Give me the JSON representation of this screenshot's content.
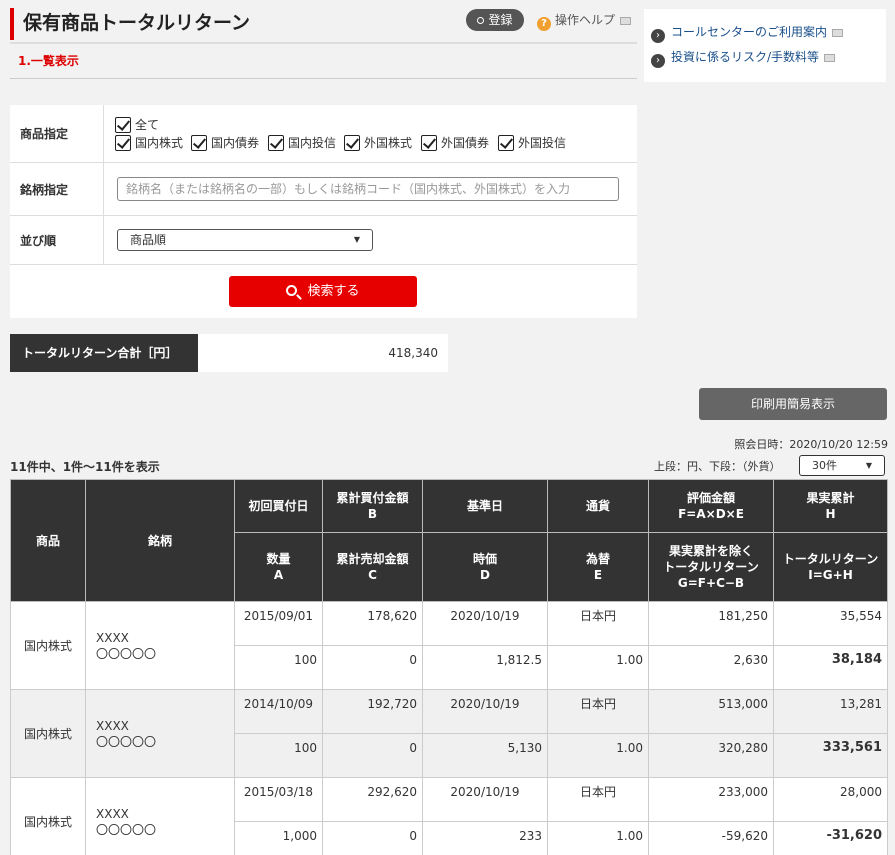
{
  "header": {
    "title": "保有商品トータルリターン",
    "register_label": "登録",
    "help_label": "操作ヘルプ",
    "section": "1.一覧表示"
  },
  "info_links": [
    {
      "label": "コールセンターのご利用案内"
    },
    {
      "label": "投資に係るリスク/手数料等"
    }
  ],
  "form": {
    "product_label": "商品指定",
    "checkboxes": [
      {
        "label": "全て",
        "checked": true
      },
      {
        "label": "国内株式",
        "checked": true
      },
      {
        "label": "国内債券",
        "checked": true
      },
      {
        "label": "国内投信",
        "checked": true
      },
      {
        "label": "外国株式",
        "checked": true
      },
      {
        "label": "外国債券",
        "checked": true
      },
      {
        "label": "外国投信",
        "checked": true
      }
    ],
    "stock_label": "銘柄指定",
    "stock_placeholder": "銘柄名（または銘柄名の一部）もしくは銘柄コード（国内株式、外国株式）を入力",
    "sort_label": "並び順",
    "sort_value": "商品順",
    "search_label": "検索する"
  },
  "total": {
    "label": "トータルリターン合計［円］",
    "value": "418,340"
  },
  "print_label": "印刷用簡易表示",
  "query_time": "照会日時：2020/10/20 12:59",
  "count_text": "11件中、1件～11件を表示",
  "units_text": "上段：円、下段：（外貨）",
  "per_page": "30件",
  "table": {
    "headers": {
      "product": "商品",
      "name": "銘柄",
      "first_buy": "初回買付日",
      "buy_total": [
        "累計買付金額",
        "B"
      ],
      "base_date": "基準日",
      "currency": "通貨",
      "valuation": [
        "評価金額",
        "F=A×D×E"
      ],
      "realized": [
        "果実累計",
        "H"
      ],
      "qty": [
        "数量",
        "A"
      ],
      "sell_total": [
        "累計売却金額",
        "C"
      ],
      "price": [
        "時価",
        "D"
      ],
      "fx": [
        "為替",
        "E"
      ],
      "excl": [
        "果実累計を除く",
        "トータルリターン",
        "G=F+C−B"
      ],
      "tr": [
        "トータルリターン",
        "I=G+H"
      ]
    },
    "rows": [
      {
        "product": "国内株式",
        "name1": "XXXX",
        "name2": "〇〇〇〇〇",
        "top": [
          "2015/09/01",
          "178,620",
          "2020/10/19",
          "日本円",
          "181,250",
          "35,554"
        ],
        "bottom": [
          "100",
          "0",
          "1,812.5",
          "1.00",
          "2,630",
          "38,184"
        ]
      },
      {
        "product": "国内株式",
        "name1": "XXXX",
        "name2": "〇〇〇〇〇",
        "top": [
          "2014/10/09",
          "192,720",
          "2020/10/19",
          "日本円",
          "513,000",
          "13,281"
        ],
        "bottom": [
          "100",
          "0",
          "5,130",
          "1.00",
          "320,280",
          "333,561"
        ]
      },
      {
        "product": "国内株式",
        "name1": "XXXX",
        "name2": "〇〇〇〇〇",
        "top": [
          "2015/03/18",
          "292,620",
          "2020/10/19",
          "日本円",
          "233,000",
          "28,000"
        ],
        "bottom": [
          "1,000",
          "0",
          "233",
          "1.00",
          "-59,620",
          "-31,620"
        ]
      }
    ]
  }
}
